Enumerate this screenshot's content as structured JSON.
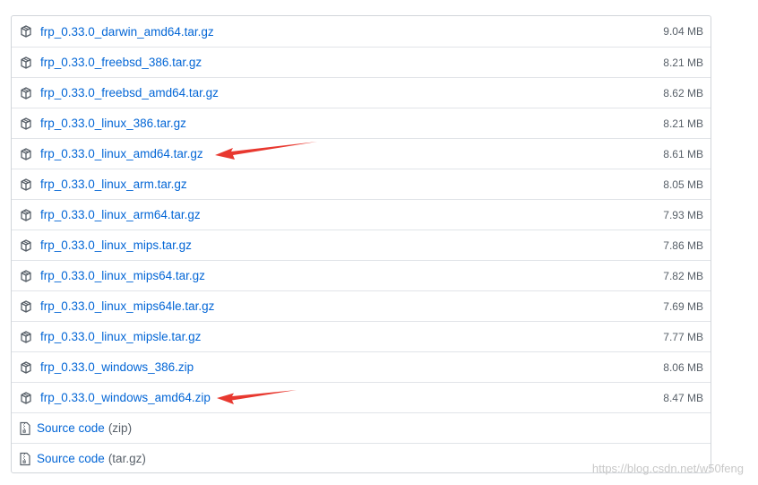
{
  "assets": [
    {
      "name": "frp_0.33.0_darwin_amd64.tar.gz",
      "size": "9.04 MB"
    },
    {
      "name": "frp_0.33.0_freebsd_386.tar.gz",
      "size": "8.21 MB"
    },
    {
      "name": "frp_0.33.0_freebsd_amd64.tar.gz",
      "size": "8.62 MB"
    },
    {
      "name": "frp_0.33.0_linux_386.tar.gz",
      "size": "8.21 MB"
    },
    {
      "name": "frp_0.33.0_linux_amd64.tar.gz",
      "size": "8.61 MB"
    },
    {
      "name": "frp_0.33.0_linux_arm.tar.gz",
      "size": "8.05 MB"
    },
    {
      "name": "frp_0.33.0_linux_arm64.tar.gz",
      "size": "7.93 MB"
    },
    {
      "name": "frp_0.33.0_linux_mips.tar.gz",
      "size": "7.86 MB"
    },
    {
      "name": "frp_0.33.0_linux_mips64.tar.gz",
      "size": "7.82 MB"
    },
    {
      "name": "frp_0.33.0_linux_mips64le.tar.gz",
      "size": "7.69 MB"
    },
    {
      "name": "frp_0.33.0_linux_mipsle.tar.gz",
      "size": "7.77 MB"
    },
    {
      "name": "frp_0.33.0_windows_386.zip",
      "size": "8.06 MB"
    },
    {
      "name": "frp_0.33.0_windows_amd64.zip",
      "size": "8.47 MB"
    }
  ],
  "source_code": [
    {
      "label": "Source code",
      "format": "(zip)"
    },
    {
      "label": "Source code",
      "format": "(tar.gz)"
    }
  ],
  "icons": {
    "asset": "package-icon",
    "source": "file-zip-icon",
    "annotation": "red-arrow"
  },
  "colors": {
    "link": "#0366d6",
    "muted": "#586069",
    "border": "#e1e4e8",
    "arrow": "#e8382f"
  },
  "watermark": "https://blog.csdn.net/w50feng"
}
